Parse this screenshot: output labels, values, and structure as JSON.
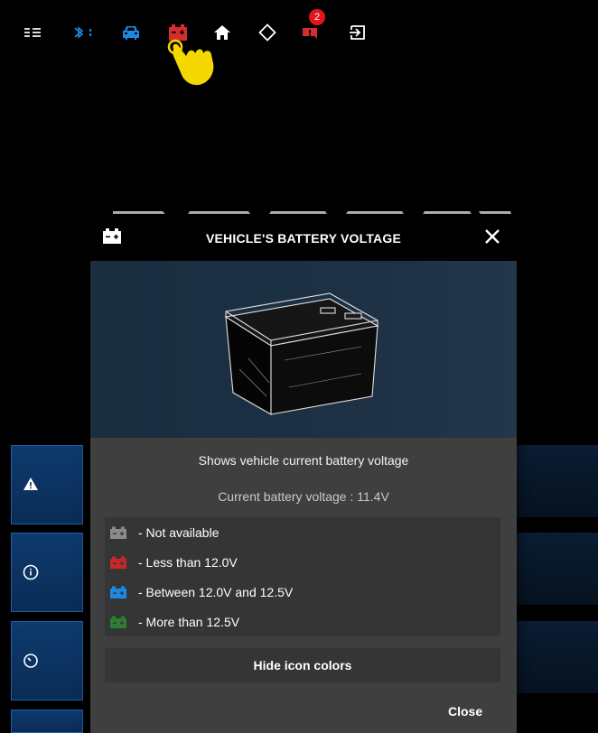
{
  "topbar": {
    "icons": [
      "menu-icon",
      "bluetooth-icon",
      "car-icon",
      "battery-icon",
      "home-icon",
      "rotate-icon",
      "notifications-icon",
      "exit-icon"
    ],
    "notification_count": "2",
    "colors": {
      "blue": "#1e88e5",
      "battery_red": "#d32f2f",
      "notify_red": "#e3141b"
    }
  },
  "dialog": {
    "title": "VEHICLE'S BATTERY VOLTAGE",
    "description": "Shows vehicle current battery voltage",
    "current_voltage": "Current battery voltage : 11.4V",
    "legend": [
      {
        "label": "- Not available",
        "color": "#8a8a8a"
      },
      {
        "label": "- Less than 12.0V",
        "color": "#c62828"
      },
      {
        "label": "- Between 12.0V and 12.5V",
        "color": "#1e88e5"
      },
      {
        "label": "- More than 12.5V",
        "color": "#2e7d32"
      }
    ],
    "hide_button": "Hide icon colors",
    "close_button": "Close"
  }
}
